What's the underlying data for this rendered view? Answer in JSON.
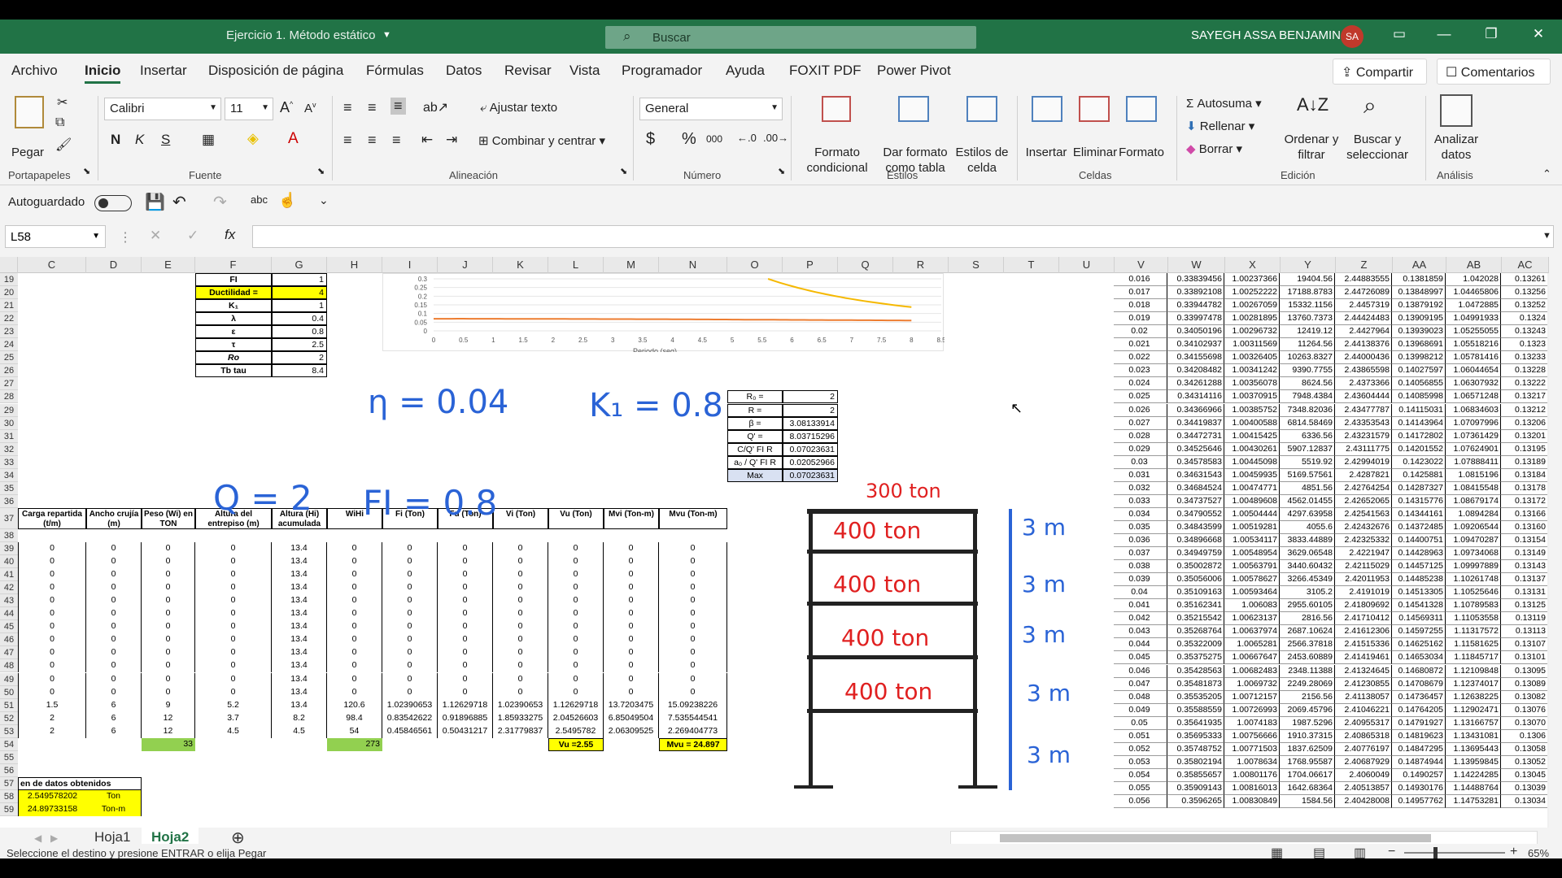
{
  "window": {
    "title": "Ejercicio 1. Método estático",
    "search_placeholder": "Buscar",
    "user": "SAYEGH ASSA BENJAMIN",
    "avatar": "SA"
  },
  "menu": [
    "Archivo",
    "Inicio",
    "Insertar",
    "Disposición de página",
    "Fórmulas",
    "Datos",
    "Revisar",
    "Vista",
    "Programador",
    "Ayuda",
    "FOXIT PDF",
    "Power Pivot"
  ],
  "share": "Compartir",
  "comments": "Comentarios",
  "ribbon": {
    "paste": "Pegar",
    "font": "Calibri",
    "size": "11",
    "bold": "N",
    "italic": "K",
    "underline": "S",
    "wrap": "Ajustar texto",
    "merge": "Combinar y centrar",
    "numfmt": "General",
    "cond": "Formato condicional",
    "table": "Dar formato como tabla",
    "styles": "Estilos de celda",
    "insert": "Insertar",
    "delete": "Eliminar",
    "format": "Formato",
    "autosum": "Autosuma",
    "fill": "Rellenar",
    "clear": "Borrar",
    "sort": "Ordenar y filtrar",
    "find": "Buscar y seleccionar",
    "analyze": "Analizar datos",
    "groups": [
      "Portapapeles",
      "Fuente",
      "Alineación",
      "Número",
      "Estilos",
      "Celdas",
      "Edición",
      "Análisis"
    ]
  },
  "qat": {
    "autosave": "Autoguardado"
  },
  "namebox": "L58",
  "columns": [
    "C",
    "D",
    "E",
    "F",
    "G",
    "H",
    "I",
    "J",
    "K",
    "L",
    "M",
    "N",
    "O",
    "P",
    "Q",
    "R",
    "S",
    "T",
    "U",
    "V",
    "W",
    "X",
    "Y",
    "Z",
    "AA",
    "AB",
    "AC"
  ],
  "rows": [
    "19",
    "20",
    "21",
    "22",
    "23",
    "24",
    "25",
    "26",
    "27",
    "28",
    "29",
    "30",
    "31",
    "32",
    "33",
    "34",
    "35",
    "36",
    "37",
    "38",
    "39",
    "40",
    "41",
    "42",
    "43",
    "44",
    "45",
    "46",
    "47",
    "48",
    "49",
    "50",
    "51",
    "52",
    "53",
    "54",
    "55",
    "56",
    "57",
    "58",
    "59"
  ],
  "params": [
    [
      "FI",
      "1"
    ],
    [
      "Ductilidad =",
      "4"
    ],
    [
      "K₁",
      "1"
    ],
    [
      "λ",
      "0.4"
    ],
    [
      "ε",
      "0.8"
    ],
    [
      "τ",
      "2.5"
    ],
    [
      "Ro",
      "2"
    ],
    [
      "Tb tau",
      "8.4"
    ]
  ],
  "chart": {
    "xlabel": "Periodo (seg)",
    "xticks": [
      "0",
      "0.5",
      "1",
      "1.5",
      "2",
      "2.5",
      "3",
      "3.5",
      "4",
      "4.5",
      "5",
      "5.5",
      "6",
      "6.5",
      "7",
      "7.5",
      "8",
      "8.5"
    ],
    "yticks": [
      "0.3",
      "0.25",
      "0.2",
      "0.15",
      "0.1",
      "0.05",
      "0"
    ]
  },
  "boxparams": [
    [
      "R₀ =",
      "2"
    ],
    [
      "R =",
      "2"
    ],
    [
      "β =",
      "3.08133914"
    ],
    [
      "Q' =",
      "8.03715296"
    ],
    [
      "C/Q' FI R",
      "0.07023631"
    ],
    [
      "a₀ / Q' FI R",
      "0.02052966"
    ],
    [
      "Max",
      "0.07023631"
    ]
  ],
  "main_headers": [
    "Carga repartida (t/m)",
    "Ancho crujía (m)",
    "Peso (Wi) en TON",
    "Altura del entrepiso (m)",
    "Altura (Hi) acumulada",
    "WiHi",
    "Fi (Ton)",
    "Fu (Ton)",
    "Vi (Ton)",
    "Vu (Ton)",
    "Mvi (Ton-m)",
    "Mvu (Ton-m)"
  ],
  "main_rows": [
    [
      "0",
      "0",
      "0",
      "0",
      "13.4",
      "0",
      "0",
      "0",
      "0",
      "0",
      "0",
      "0"
    ],
    [
      "0",
      "0",
      "0",
      "0",
      "13.4",
      "0",
      "0",
      "0",
      "0",
      "0",
      "0",
      "0"
    ],
    [
      "0",
      "0",
      "0",
      "0",
      "13.4",
      "0",
      "0",
      "0",
      "0",
      "0",
      "0",
      "0"
    ],
    [
      "0",
      "0",
      "0",
      "0",
      "13.4",
      "0",
      "0",
      "0",
      "0",
      "0",
      "0",
      "0"
    ],
    [
      "0",
      "0",
      "0",
      "0",
      "13.4",
      "0",
      "0",
      "0",
      "0",
      "0",
      "0",
      "0"
    ],
    [
      "0",
      "0",
      "0",
      "0",
      "13.4",
      "0",
      "0",
      "0",
      "0",
      "0",
      "0",
      "0"
    ],
    [
      "0",
      "0",
      "0",
      "0",
      "13.4",
      "0",
      "0",
      "0",
      "0",
      "0",
      "0",
      "0"
    ],
    [
      "0",
      "0",
      "0",
      "0",
      "13.4",
      "0",
      "0",
      "0",
      "0",
      "0",
      "0",
      "0"
    ],
    [
      "0",
      "0",
      "0",
      "0",
      "13.4",
      "0",
      "0",
      "0",
      "0",
      "0",
      "0",
      "0"
    ],
    [
      "0",
      "0",
      "0",
      "0",
      "13.4",
      "0",
      "0",
      "0",
      "0",
      "0",
      "0",
      "0"
    ],
    [
      "0",
      "0",
      "0",
      "0",
      "13.4",
      "0",
      "0",
      "0",
      "0",
      "0",
      "0",
      "0"
    ],
    [
      "0",
      "0",
      "0",
      "0",
      "13.4",
      "0",
      "0",
      "0",
      "0",
      "0",
      "0",
      "0"
    ],
    [
      "1.5",
      "6",
      "9",
      "5.2",
      "13.4",
      "120.6",
      "1.02390653",
      "1.12629718",
      "1.02390653",
      "1.12629718",
      "13.7203475",
      "15.09238226"
    ],
    [
      "2",
      "6",
      "12",
      "3.7",
      "8.2",
      "98.4",
      "0.83542622",
      "0.91896885",
      "1.85933275",
      "2.04526603",
      "6.85049504",
      "7.535544541"
    ],
    [
      "2",
      "6",
      "12",
      "4.5",
      "4.5",
      "54",
      "0.45846561",
      "0.50431217",
      "2.31779837",
      "2.5495782",
      "2.06309525",
      "2.269404773"
    ]
  ],
  "totals": {
    "peso": "33",
    "wihi": "273",
    "vu": "Vu =2.55",
    "mvu": "Mvu = 24.897"
  },
  "summary": {
    "title": "en de datos obtenidos",
    "r1": [
      "2.549578202",
      "Ton"
    ],
    "r2": [
      "24.89733158",
      "Ton-m"
    ]
  },
  "handwriting": {
    "eta": "η = 0.04",
    "k1": "K₁ = 0.8",
    "q": "Q = 2",
    "fi": "FI = 0.8",
    "top": "300 ton",
    "floors": [
      "400 ton",
      "400 ton",
      "400 ton",
      "400 ton"
    ],
    "heights": [
      "3 m",
      "3 m",
      "3 m",
      "3 m",
      "3 m"
    ]
  },
  "vtable": [
    [
      "0.016",
      "0.33839456",
      "1.00237366",
      "19404.56",
      "2.44883555",
      "0.1381859",
      "1.042028",
      "0.13261"
    ],
    [
      "0.017",
      "0.33892108",
      "1.00252222",
      "17188.8783",
      "2.44726089",
      "0.13848997",
      "1.04465806",
      "0.13256"
    ],
    [
      "0.018",
      "0.33944782",
      "1.00267059",
      "15332.1156",
      "2.4457319",
      "0.13879192",
      "1.0472885",
      "0.13252"
    ],
    [
      "0.019",
      "0.33997478",
      "1.00281895",
      "13760.7373",
      "2.44424483",
      "0.13909195",
      "1.04991933",
      "0.1324"
    ],
    [
      "0.02",
      "0.34050196",
      "1.00296732",
      "12419.12",
      "2.4427964",
      "0.13939023",
      "1.05255055",
      "0.13243"
    ],
    [
      "0.021",
      "0.34102937",
      "1.00311569",
      "11264.56",
      "2.44138376",
      "0.13968691",
      "1.05518216",
      "0.1323"
    ],
    [
      "0.022",
      "0.34155698",
      "1.00326405",
      "10263.8327",
      "2.44000436",
      "0.13998212",
      "1.05781416",
      "0.13233"
    ],
    [
      "0.023",
      "0.34208482",
      "1.00341242",
      "9390.7755",
      "2.43865598",
      "0.14027597",
      "1.06044654",
      "0.13228"
    ],
    [
      "0.024",
      "0.34261288",
      "1.00356078",
      "8624.56",
      "2.4373366",
      "0.14056855",
      "1.06307932",
      "0.13222"
    ],
    [
      "0.025",
      "0.34314116",
      "1.00370915",
      "7948.4384",
      "2.43604444",
      "0.14085998",
      "1.06571248",
      "0.13217"
    ],
    [
      "0.026",
      "0.34366966",
      "1.00385752",
      "7348.82036",
      "2.43477787",
      "0.14115031",
      "1.06834603",
      "0.13212"
    ],
    [
      "0.027",
      "0.34419837",
      "1.00400588",
      "6814.58469",
      "2.43353543",
      "0.14143964",
      "1.07097996",
      "0.13206"
    ],
    [
      "0.028",
      "0.34472731",
      "1.00415425",
      "6336.56",
      "2.43231579",
      "0.14172802",
      "1.07361429",
      "0.13201"
    ],
    [
      "0.029",
      "0.34525646",
      "1.00430261",
      "5907.12837",
      "2.43111775",
      "0.14201552",
      "1.07624901",
      "0.13195"
    ],
    [
      "0.03",
      "0.34578583",
      "1.00445098",
      "5519.92",
      "2.42994019",
      "0.1423022",
      "1.07888411",
      "0.13189"
    ],
    [
      "0.031",
      "0.34631543",
      "1.00459935",
      "5169.57561",
      "2.4287821",
      "0.1425881",
      "1.0815196",
      "0.13184"
    ],
    [
      "0.032",
      "0.34684524",
      "1.00474771",
      "4851.56",
      "2.42764254",
      "0.14287327",
      "1.08415548",
      "0.13178"
    ],
    [
      "0.033",
      "0.34737527",
      "1.00489608",
      "4562.01455",
      "2.42652065",
      "0.14315776",
      "1.08679174",
      "0.13172"
    ],
    [
      "0.034",
      "0.34790552",
      "1.00504444",
      "4297.63958",
      "2.42541563",
      "0.14344161",
      "1.0894284",
      "0.13166"
    ],
    [
      "0.035",
      "0.34843599",
      "1.00519281",
      "4055.6",
      "2.42432676",
      "0.14372485",
      "1.09206544",
      "0.13160"
    ],
    [
      "0.036",
      "0.34896668",
      "1.00534117",
      "3833.44889",
      "2.42325332",
      "0.14400751",
      "1.09470287",
      "0.13154"
    ],
    [
      "0.037",
      "0.34949759",
      "1.00548954",
      "3629.06548",
      "2.4221947",
      "0.14428963",
      "1.09734068",
      "0.13149"
    ],
    [
      "0.038",
      "0.35002872",
      "1.00563791",
      "3440.60432",
      "2.42115029",
      "0.14457125",
      "1.09997889",
      "0.13143"
    ],
    [
      "0.039",
      "0.35056006",
      "1.00578627",
      "3266.45349",
      "2.42011953",
      "0.14485238",
      "1.10261748",
      "0.13137"
    ],
    [
      "0.04",
      "0.35109163",
      "1.00593464",
      "3105.2",
      "2.4191019",
      "0.14513305",
      "1.10525646",
      "0.13131"
    ],
    [
      "0.041",
      "0.35162341",
      "1.006083",
      "2955.60105",
      "2.41809692",
      "0.14541328",
      "1.10789583",
      "0.13125"
    ],
    [
      "0.042",
      "0.35215542",
      "1.00623137",
      "2816.56",
      "2.41710412",
      "0.14569311",
      "1.11053558",
      "0.13119"
    ],
    [
      "0.043",
      "0.35268764",
      "1.00637974",
      "2687.10624",
      "2.41612306",
      "0.14597255",
      "1.11317572",
      "0.13113"
    ],
    [
      "0.044",
      "0.35322009",
      "1.0065281",
      "2566.37818",
      "2.41515336",
      "0.14625162",
      "1.11581625",
      "0.13107"
    ],
    [
      "0.045",
      "0.35375275",
      "1.00667647",
      "2453.60889",
      "2.41419461",
      "0.14653034",
      "1.11845717",
      "0.13101"
    ],
    [
      "0.046",
      "0.35428563",
      "1.00682483",
      "2348.11388",
      "2.41324645",
      "0.14680872",
      "1.12109848",
      "0.13095"
    ],
    [
      "0.047",
      "0.35481873",
      "1.0069732",
      "2249.28069",
      "2.41230855",
      "0.14708679",
      "1.12374017",
      "0.13089"
    ],
    [
      "0.048",
      "0.35535205",
      "1.00712157",
      "2156.56",
      "2.41138057",
      "0.14736457",
      "1.12638225",
      "0.13082"
    ],
    [
      "0.049",
      "0.35588559",
      "1.00726993",
      "2069.45796",
      "2.41046221",
      "0.14764205",
      "1.12902471",
      "0.13076"
    ],
    [
      "0.05",
      "0.35641935",
      "1.0074183",
      "1987.5296",
      "2.40955317",
      "0.14791927",
      "1.13166757",
      "0.13070"
    ],
    [
      "0.051",
      "0.35695333",
      "1.00756666",
      "1910.37315",
      "2.40865318",
      "0.14819623",
      "1.13431081",
      "0.1306"
    ],
    [
      "0.052",
      "0.35748752",
      "1.00771503",
      "1837.62509",
      "2.40776197",
      "0.14847295",
      "1.13695443",
      "0.13058"
    ],
    [
      "0.053",
      "0.35802194",
      "1.0078634",
      "1768.95587",
      "2.40687929",
      "0.14874944",
      "1.13959845",
      "0.13052"
    ],
    [
      "0.054",
      "0.35855657",
      "1.00801176",
      "1704.06617",
      "2.4060049",
      "0.1490257",
      "1.14224285",
      "0.13045"
    ],
    [
      "0.055",
      "0.35909143",
      "1.00816013",
      "1642.68364",
      "2.40513857",
      "0.14930176",
      "1.14488764",
      "0.13039"
    ],
    [
      "0.056",
      "0.3596265",
      "1.00830849",
      "1584.56",
      "2.40428008",
      "0.14957762",
      "1.14753281",
      "0.13034"
    ]
  ],
  "sheets": [
    "Hoja1",
    "Hoja2"
  ],
  "status": "Seleccione el destino y presione ENTRAR o elija Pegar",
  "zoom": "65%"
}
